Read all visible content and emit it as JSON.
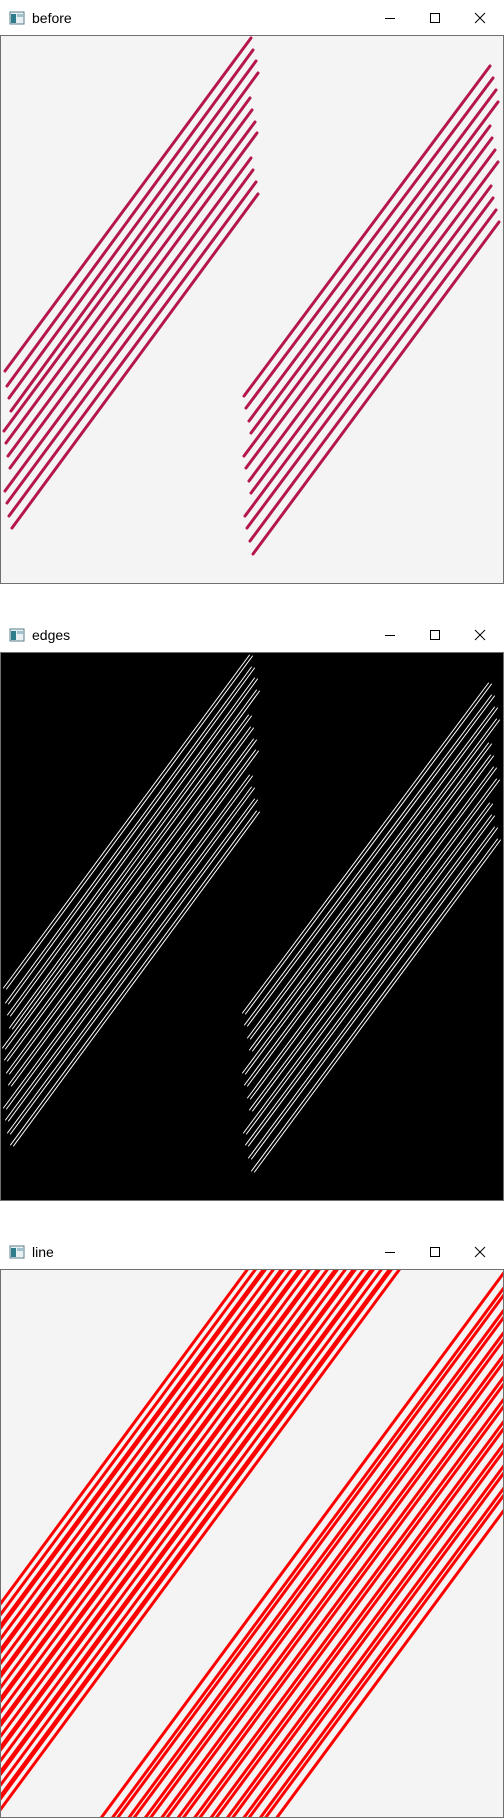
{
  "windows": [
    {
      "id": "before",
      "title": "before"
    },
    {
      "id": "edges",
      "title": "edges"
    },
    {
      "id": "line",
      "title": "line"
    }
  ],
  "colors": {
    "before_background": "#f4f4f4",
    "before_lines": "#b5174a",
    "edges_background": "#000000",
    "edges_lines": "#ffffff",
    "line_background": "#f4f4f4",
    "line_lines": "#ff0000"
  },
  "icons": [
    "app-window-icon",
    "minimize-icon",
    "maximize-icon",
    "close-icon"
  ]
}
